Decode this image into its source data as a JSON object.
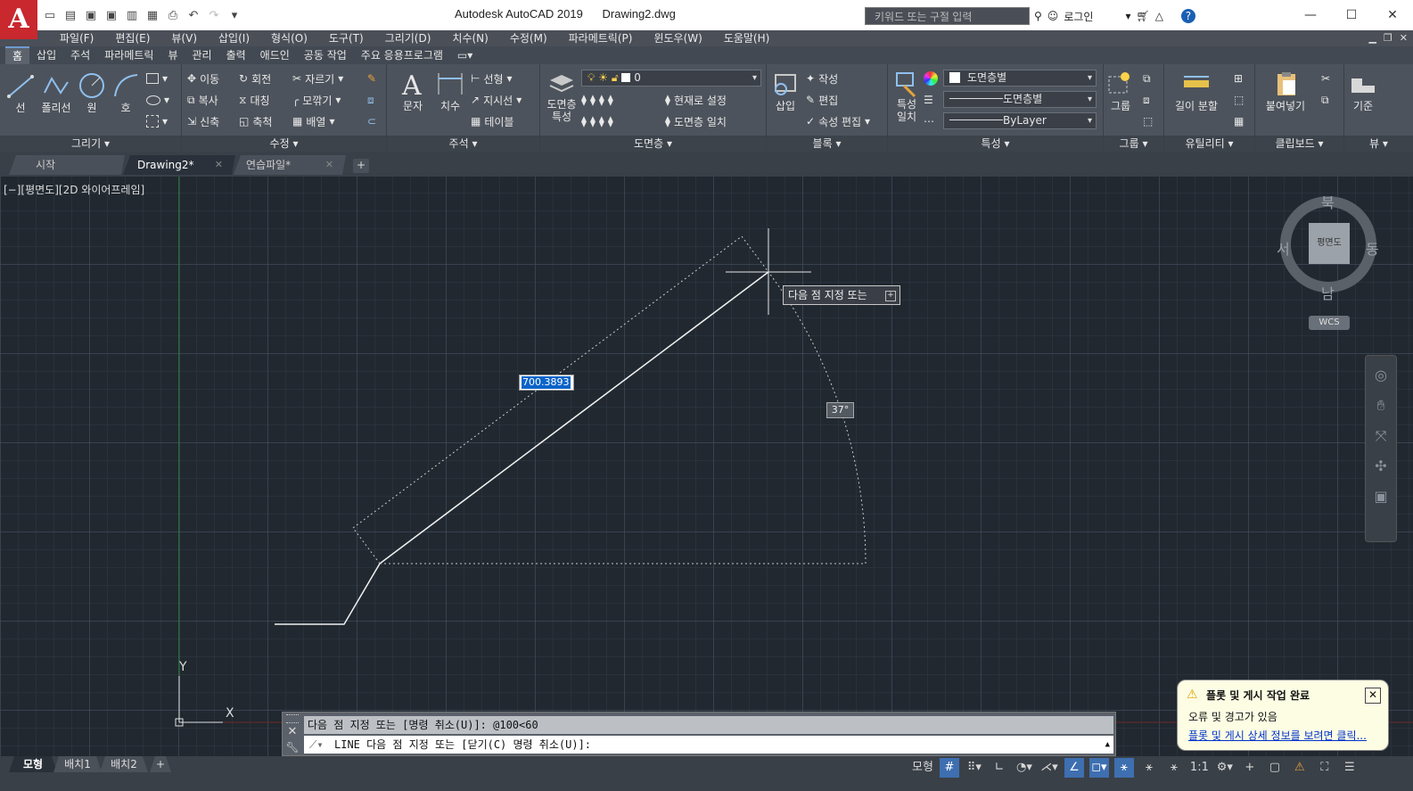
{
  "titlebar": {
    "app_name": "Autodesk AutoCAD 2019",
    "file_name": "Drawing2.dwg",
    "search_placeholder": "키워드 또는 구절 입력",
    "login_label": "로그인"
  },
  "menu": [
    "파일(F)",
    "편집(E)",
    "뷰(V)",
    "삽입(I)",
    "형식(O)",
    "도구(T)",
    "그리기(D)",
    "치수(N)",
    "수정(M)",
    "파라메트릭(P)",
    "윈도우(W)",
    "도움말(H)"
  ],
  "ribbon_tabs": [
    "홈",
    "삽입",
    "주석",
    "파라메트릭",
    "뷰",
    "관리",
    "출력",
    "애드인",
    "공동 작업",
    "주요 응용프로그램"
  ],
  "ribbon": {
    "draw": {
      "title": "그리기",
      "line": "선",
      "polyline": "폴리선",
      "circle": "원",
      "arc": "호"
    },
    "modify": {
      "title": "수정",
      "move": "이동",
      "rotate": "회전",
      "trim": "자르기",
      "copy": "복사",
      "mirror": "대칭",
      "fillet": "모깎기",
      "stretch": "신축",
      "scale": "축척",
      "array": "배열"
    },
    "annotation": {
      "title": "주석",
      "text": "문자",
      "dimension": "치수",
      "linear": "선형",
      "leader": "지시선",
      "table": "테이블"
    },
    "layers": {
      "title": "도면층",
      "properties_line1": "도면층",
      "properties_line2": "특성",
      "current_layer": "0",
      "set_current": "현재로 설정",
      "match_layer": "도면층 일치"
    },
    "block": {
      "title": "블록",
      "insert": "삽입",
      "create": "작성",
      "edit": "편집",
      "edit_attributes": "속성 편집"
    },
    "properties": {
      "title": "특성",
      "match_line1": "특성",
      "match_line2": "일치",
      "color": "도면층별",
      "linetype": "도면층별",
      "lineweight": "ByLayer"
    },
    "groups": {
      "title": "그룹",
      "group": "그룹"
    },
    "utilities": {
      "title": "유틸리티",
      "measure": "길이 분할"
    },
    "clipboard": {
      "title": "클립보드",
      "paste": "붙여넣기"
    },
    "view": {
      "title": "뷰",
      "base": "기준"
    }
  },
  "file_tabs": [
    {
      "label": "시작"
    },
    {
      "label": "Drawing2*"
    },
    {
      "label": "연습파일*"
    }
  ],
  "viewport_label": "[−][평면도][2D 와이어프레임]",
  "dynamic_input": {
    "prompt": "다음 점 지정 또는",
    "length": "700.3893",
    "angle": "37°"
  },
  "viewcube": {
    "north": "북",
    "south": "남",
    "east": "동",
    "west": "서",
    "face": "평면도",
    "wcs": "WCS"
  },
  "ucs": {
    "x": "X",
    "y": "Y"
  },
  "command_line": {
    "history": "다음 점 지정 또는 [명령 취소(U)]: @100<60",
    "input": "LINE 다음 점 지정 또는 [닫기(C) 명령 취소(U)]:"
  },
  "notification": {
    "title": "플롯 및 게시 작업 완료",
    "body": "오류 및 경고가 있음",
    "link": "플롯 및 게시 상세 정보를 보려면 클릭..."
  },
  "layout_tabs": [
    "모형",
    "배치1",
    "배치2"
  ],
  "status": {
    "model": "모형",
    "scale": "1:1"
  },
  "colors": {
    "accent": "#c8282e",
    "canvas": "#212830",
    "ribbon": "#4d535c",
    "highlight": "#0a64c8"
  }
}
